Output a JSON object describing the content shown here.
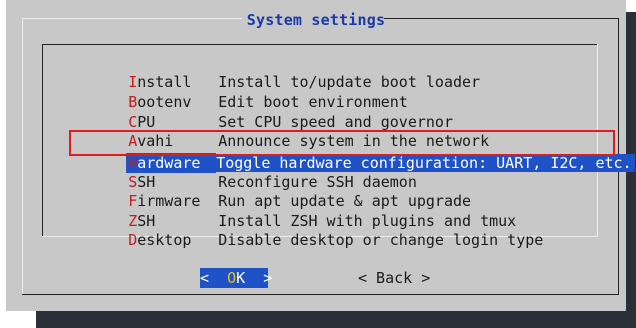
{
  "dialog": {
    "title": "System settings"
  },
  "menu": {
    "items": [
      {
        "hotkey": "I",
        "rest": "nstall",
        "description": "Install to/update boot loader"
      },
      {
        "hotkey": "B",
        "rest": "ootenv",
        "description": "Edit boot environment"
      },
      {
        "hotkey": "C",
        "rest": "PU",
        "description": "Set CPU speed and governor"
      },
      {
        "hotkey": "A",
        "rest": "vahi",
        "description": "Announce system in the network"
      },
      {
        "hotkey": "H",
        "rest": "ardware",
        "description": "Toggle hardware configuration: UART, I2C, etc."
      },
      {
        "hotkey": "S",
        "rest": "SH",
        "description": "Reconfigure SSH daemon"
      },
      {
        "hotkey": "F",
        "rest": "irmware",
        "description": "Run apt update & apt upgrade"
      },
      {
        "hotkey": "Z",
        "rest": "SH",
        "description": "Install ZSH with plugins and tmux"
      },
      {
        "hotkey": "D",
        "rest": "esktop",
        "description": "Disable desktop or change login type"
      }
    ],
    "selected_item": "Hardware"
  },
  "buttons": {
    "ok_left": "<  ",
    "ok_hotkey": "O",
    "ok_rest": "K",
    "ok_right": "  >",
    "back_label": "< Back >"
  },
  "colors": {
    "dialog_bg": "#c8c8c8",
    "selection": "#1f52c6",
    "hotkey": "#c11d1d",
    "title": "#1a3aa8",
    "annotation_box": "#e01d1d"
  }
}
